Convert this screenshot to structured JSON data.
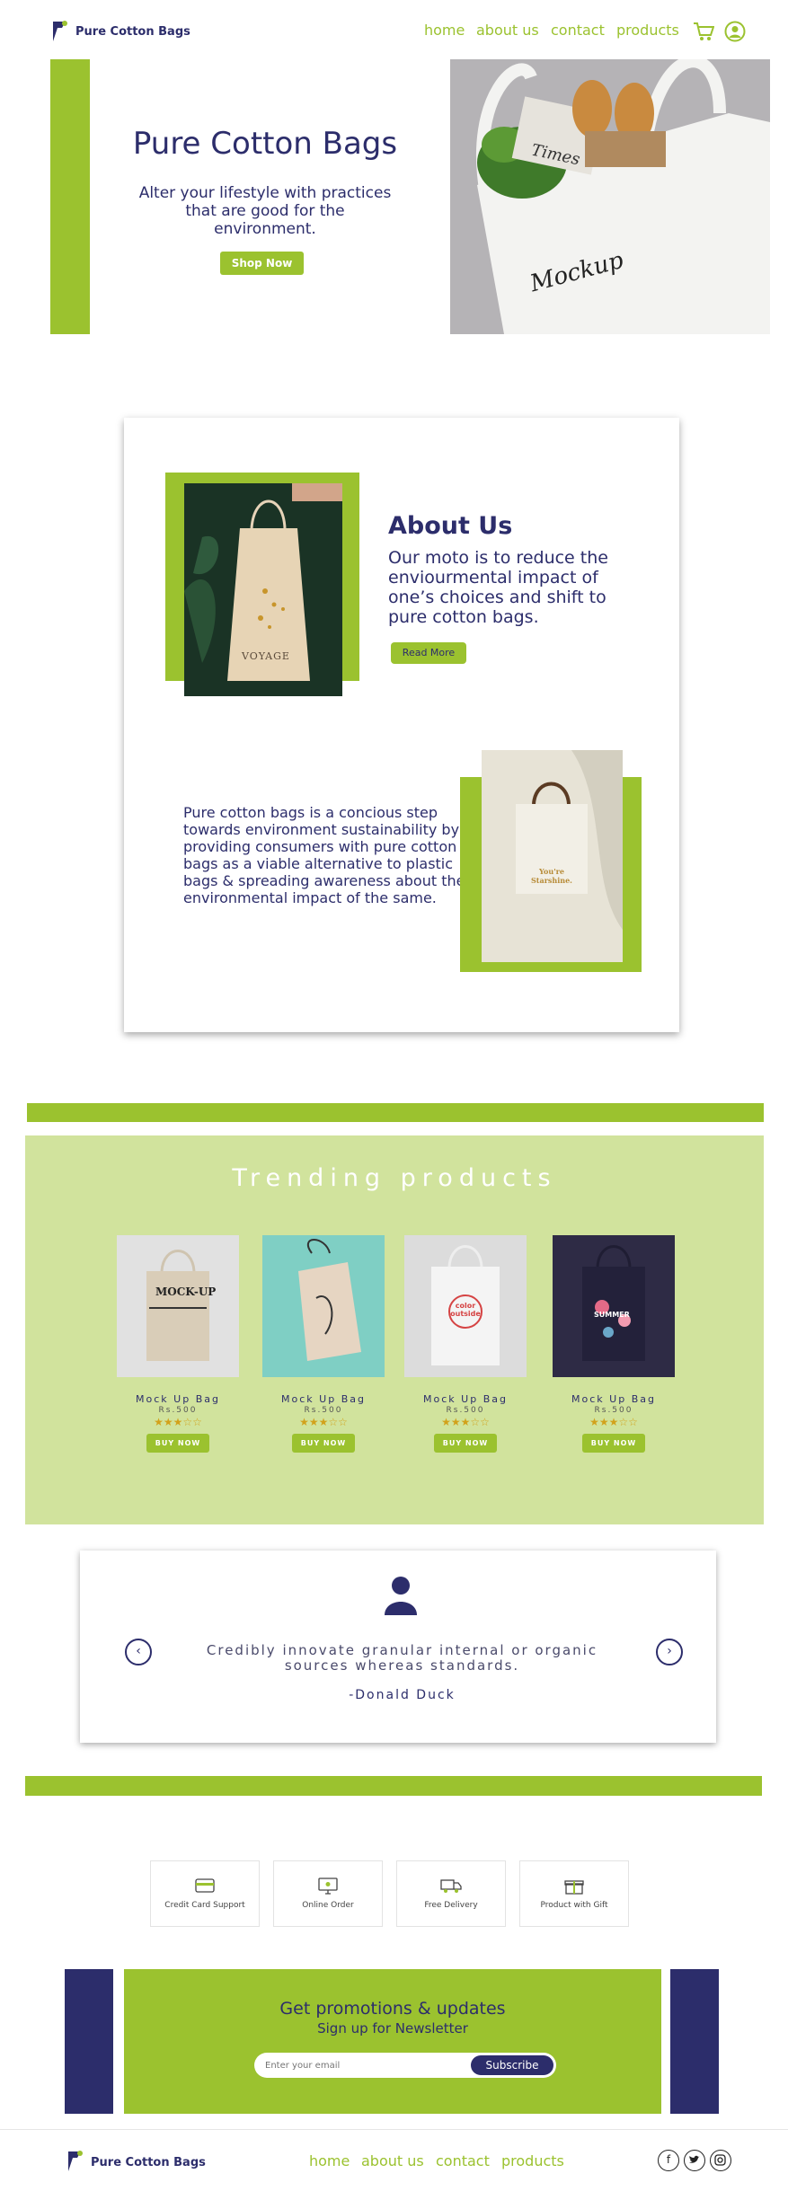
{
  "header": {
    "brand": "Pure Cotton Bags",
    "nav": [
      "home",
      "about us",
      "contact",
      "products"
    ]
  },
  "hero": {
    "title": "Pure Cotton Bags",
    "subtitle": "Alter your lifestyle with practices that are good for the environment.",
    "cta": "Shop Now",
    "image_text": "Mockup",
    "newspaper_text": "Times"
  },
  "about": {
    "title": "About Us",
    "text": "Our moto is to reduce the enviourmental impact of one’s choices and shift to pure cotton bags.",
    "read_more": "Read More",
    "paragraph": "Pure cotton bags is a concious step towards environment sustainability by providing consumers with pure cotton bags as a viable alternative to plastic bags & spreading awareness about the environmental impact of the same.",
    "bag1_text": "VOYAGE",
    "bag2_text": "You're Starshine."
  },
  "trending": {
    "title": "Trending products",
    "products": [
      {
        "name": "Mock Up Bag",
        "price": "Rs.500",
        "rating": 3.5,
        "stars": "★★★☆☆",
        "button": "BUY NOW",
        "print": "MOCK-UP"
      },
      {
        "name": "Mock Up Bag",
        "price": "Rs.500",
        "rating": 3.5,
        "stars": "★★★☆☆",
        "button": "BUY NOW",
        "print": ""
      },
      {
        "name": "Mock Up Bag",
        "price": "Rs.500",
        "rating": 3.5,
        "stars": "★★★☆☆",
        "button": "BUY NOW",
        "print": "color outside"
      },
      {
        "name": "Mock Up Bag",
        "price": "Rs.500",
        "rating": 3.5,
        "stars": "★★★☆☆",
        "button": "BUY NOW",
        "print": "SUMMER"
      }
    ]
  },
  "testimonial": {
    "quote": "Credibly innovate granular internal or organic sources whereas standards.",
    "author": "-Donald Duck",
    "prev": "‹",
    "next": "›"
  },
  "features": [
    {
      "label": "Credit Card Support",
      "icon": "credit-card-icon"
    },
    {
      "label": "Online Order",
      "icon": "monitor-icon"
    },
    {
      "label": "Free Delivery",
      "icon": "truck-icon"
    },
    {
      "label": "Product with Gift",
      "icon": "gift-icon"
    }
  ],
  "newsletter": {
    "title": "Get promotions & updates",
    "subtitle": "Sign up for Newsletter",
    "placeholder": "Enter your email",
    "button": "Subscribe"
  },
  "footer": {
    "brand": "Pure Cotton Bags",
    "nav": [
      "home",
      "about us",
      "contact",
      "products"
    ],
    "social": [
      "f",
      "t",
      "ig"
    ]
  },
  "colors": {
    "green": "#9bc22f",
    "navy": "#2c2d6b",
    "light_green": "#d1e39d"
  }
}
